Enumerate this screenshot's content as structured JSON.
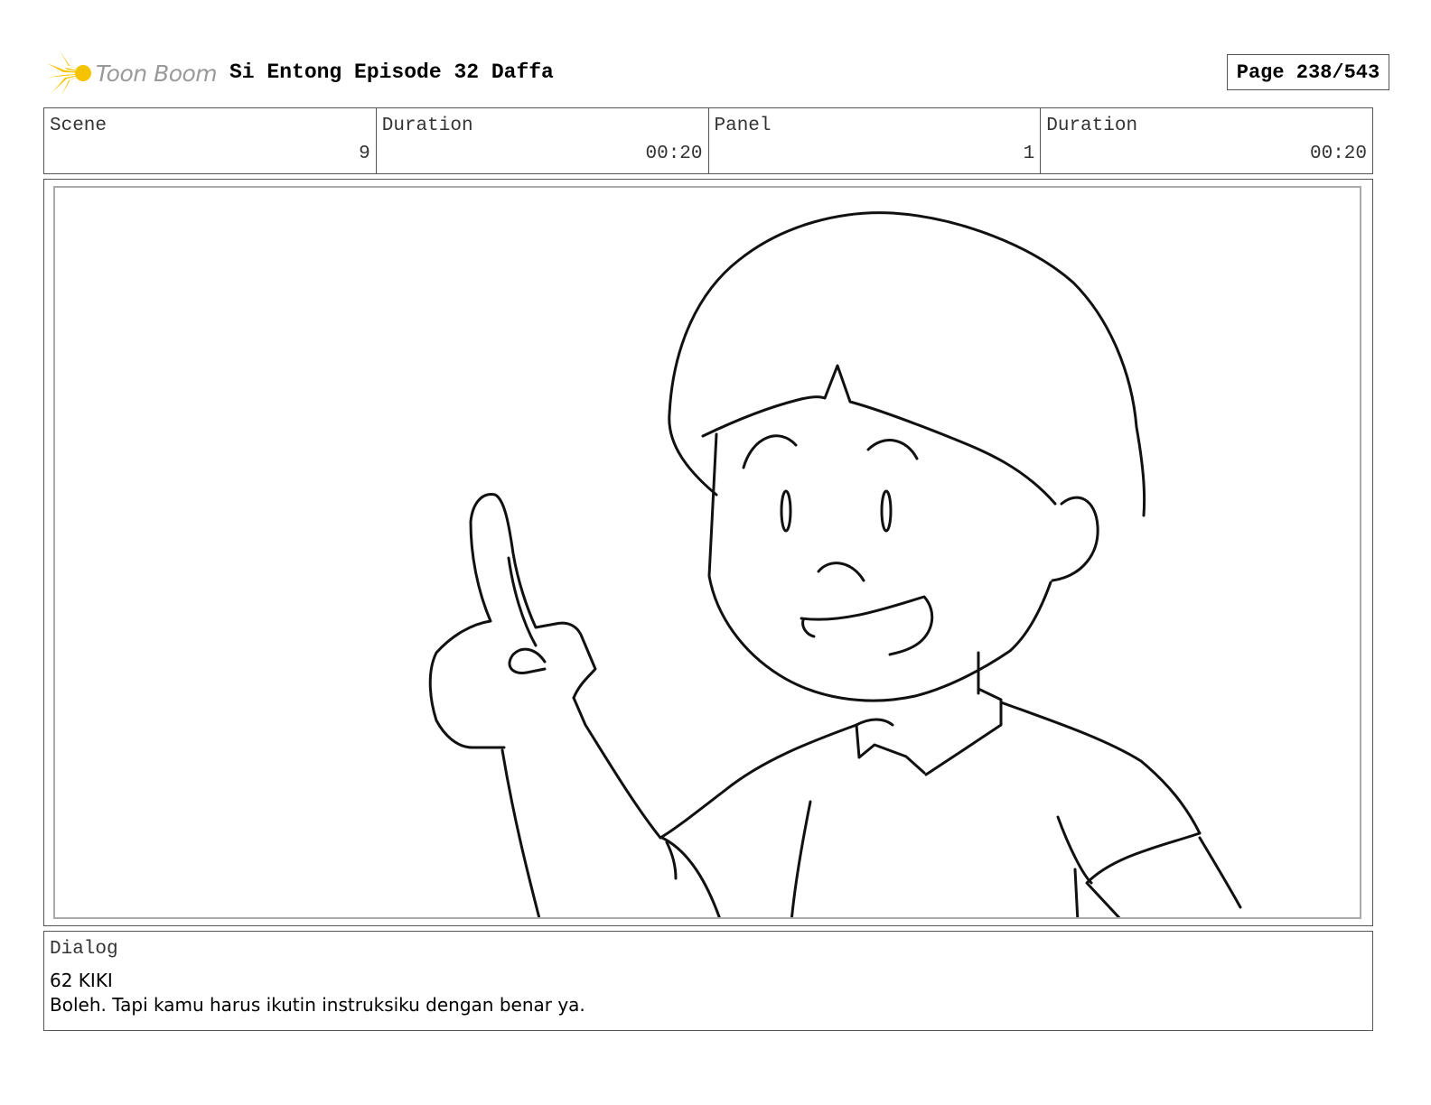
{
  "header": {
    "logo_text": "Toon Boom",
    "title": "Si Entong Episode 32 Daffa",
    "page_label": "Page 238/543"
  },
  "info": {
    "scene_label": "Scene",
    "scene_value": "9",
    "scene_duration_label": "Duration",
    "scene_duration_value": "00:20",
    "panel_label": "Panel",
    "panel_value": "1",
    "panel_duration_label": "Duration",
    "panel_duration_value": "00:20"
  },
  "dialog": {
    "label": "Dialog",
    "speaker": "62 KIKI",
    "text": "Boleh. Tapi kamu harus ikutin instruksiku dengan benar ya."
  },
  "colors": {
    "logo_accent": "#f5c400",
    "logo_text": "#9a9a9a",
    "border": "#555555"
  }
}
